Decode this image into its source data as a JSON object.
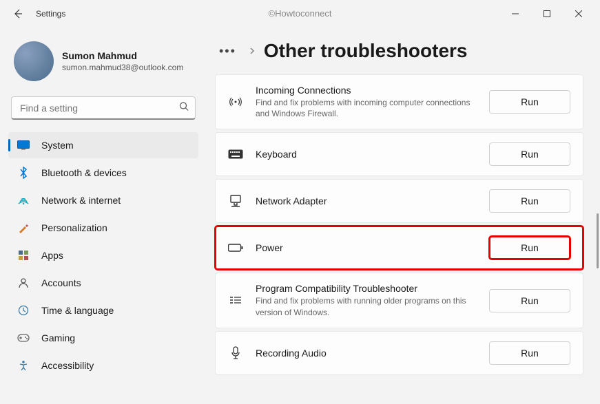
{
  "watermark": "©Howtoconnect",
  "app_title": "Settings",
  "profile": {
    "name": "Sumon Mahmud",
    "email": "sumon.mahmud38@outlook.com"
  },
  "search": {
    "placeholder": "Find a setting"
  },
  "nav": {
    "items": [
      {
        "label": "System",
        "icon": "system",
        "active": true
      },
      {
        "label": "Bluetooth & devices",
        "icon": "bluetooth",
        "active": false
      },
      {
        "label": "Network & internet",
        "icon": "network",
        "active": false
      },
      {
        "label": "Personalization",
        "icon": "personalization",
        "active": false
      },
      {
        "label": "Apps",
        "icon": "apps",
        "active": false
      },
      {
        "label": "Accounts",
        "icon": "accounts",
        "active": false
      },
      {
        "label": "Time & language",
        "icon": "time",
        "active": false
      },
      {
        "label": "Gaming",
        "icon": "gaming",
        "active": false
      },
      {
        "label": "Accessibility",
        "icon": "accessibility",
        "active": false
      }
    ]
  },
  "breadcrumb": {
    "ellipsis": "•••",
    "title": "Other troubleshooters"
  },
  "troubleshooters": [
    {
      "title": "Incoming Connections",
      "desc": "Find and fix problems with incoming computer connections and Windows Firewall.",
      "icon": "signal",
      "run": "Run",
      "highlight": false
    },
    {
      "title": "Keyboard",
      "desc": "",
      "icon": "keyboard",
      "run": "Run",
      "highlight": false
    },
    {
      "title": "Network Adapter",
      "desc": "",
      "icon": "adapter",
      "run": "Run",
      "highlight": false
    },
    {
      "title": "Power",
      "desc": "",
      "icon": "power",
      "run": "Run",
      "highlight": true
    },
    {
      "title": "Program Compatibility Troubleshooter",
      "desc": "Find and fix problems with running older programs on this version of Windows.",
      "icon": "compat",
      "run": "Run",
      "highlight": false
    },
    {
      "title": "Recording Audio",
      "desc": "",
      "icon": "mic",
      "run": "Run",
      "highlight": false
    }
  ]
}
